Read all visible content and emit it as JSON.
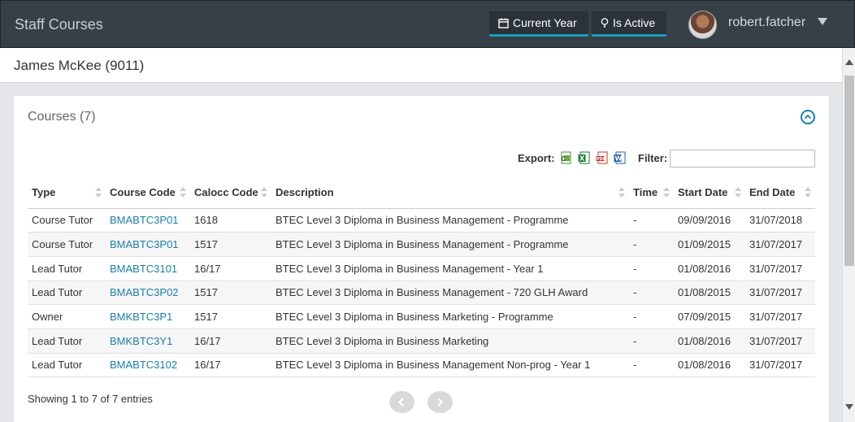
{
  "header": {
    "app_title": "Staff Courses",
    "current_year_label": "Current Year",
    "is_active_label": "Is Active",
    "username": "robert.fatcher",
    "accent_color": "#1b9bbf"
  },
  "staff": {
    "name": "James McKee (9011)"
  },
  "courses_panel": {
    "title": "Courses (7)",
    "export_label": "Export:",
    "export_icons": [
      "csv-icon",
      "excel-icon",
      "pdf-icon",
      "word-icon"
    ],
    "filter_label": "Filter:",
    "filter_value": "",
    "columns": [
      "Type",
      "Course Code",
      "Calocc Code",
      "Description",
      "Time",
      "Start Date",
      "End Date"
    ],
    "rows": [
      [
        "Course Tutor",
        "BMABTC3P01",
        "1618",
        "BTEC Level 3 Diploma in Business Management - Programme",
        "-",
        "09/09/2016",
        "31/07/2018"
      ],
      [
        "Course Tutor",
        "BMABTC3P01",
        "1517",
        "BTEC Level 3 Diploma in Business Management - Programme",
        "-",
        "01/09/2015",
        "31/07/2017"
      ],
      [
        "Lead Tutor",
        "BMABTC3101",
        "16/17",
        "BTEC Level 3 Diploma in Business Management - Year 1",
        "-",
        "01/08/2016",
        "31/07/2017"
      ],
      [
        "Lead Tutor",
        "BMABTC3P02",
        "1517",
        "BTEC Level 3 Diploma in Business Management - 720 GLH Award",
        "-",
        "01/08/2015",
        "31/07/2017"
      ],
      [
        "Owner",
        "BMKBTC3P1",
        "1517",
        "BTEC Level 3 Diploma in Business Marketing - Programme",
        "-",
        "07/09/2015",
        "31/07/2017"
      ],
      [
        "Lead Tutor",
        "BMKBTC3Y1",
        "16/17",
        "BTEC Level 3 Diploma in Business Marketing",
        "-",
        "01/08/2016",
        "31/07/2017"
      ],
      [
        "Lead Tutor",
        "BMABTC3102",
        "16/17",
        "BTEC Level 3 Diploma in Business Management Non-prog - Year 1",
        "-",
        "01/08/2016",
        "31/07/2017"
      ]
    ],
    "info": "Showing 1 to 7 of 7 entries",
    "link_color": "#1b7fa6"
  }
}
